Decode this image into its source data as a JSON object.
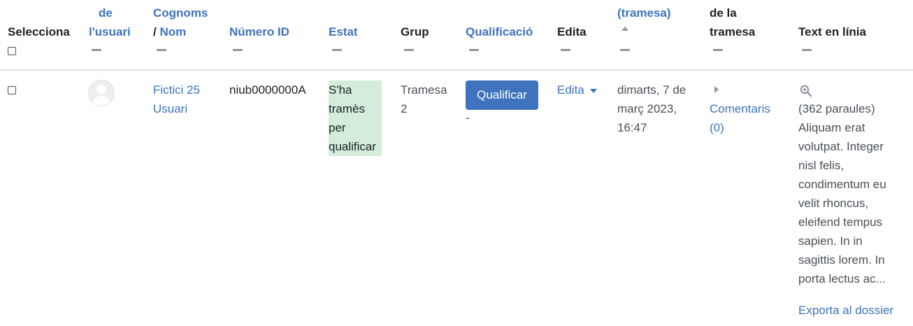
{
  "headers": {
    "select": "Selecciona",
    "picture_line1": "de",
    "picture_line2": "l'usuari",
    "name_line1": "Cognoms",
    "name_slash": "/",
    "name_line2": "Nom",
    "idnumber": "Número ID",
    "status": "Estat",
    "group": "Grup",
    "grade": "Qualificació",
    "edit": "Edita",
    "lastmodified": "(tramesa)",
    "comments_line1": "de la",
    "comments_line2": "tramesa",
    "onlinetext": "Text en línia"
  },
  "row": {
    "name_line1": "Fictici 25",
    "name_line2": "Usuari",
    "idnumber": "niub0000000A",
    "status_lines": [
      "S'ha",
      "tramès",
      "per",
      "qualificar"
    ],
    "group_line1": "Tramesa",
    "group_line2": "2",
    "grade_button": "Qualificar",
    "grade_value": "-",
    "edit_menu": "Edita",
    "modified_lines": [
      "dimarts, 7 de",
      "març 2023,",
      "16:47"
    ],
    "comments_line1": "Comentaris",
    "comments_line2": "(0)",
    "onlinetext_lines": [
      "(362 paraules)",
      "Aliquam erat",
      "volutpat. Integer",
      "nisl felis,",
      "condimentum eu",
      "velit rhoncus,",
      "eleifend tempus",
      "sapien. In in",
      "sagittis lorem. In",
      "porta lectus ac..."
    ],
    "export_link": "Exporta al dossier"
  },
  "colors": {
    "link": "#3f73bd",
    "button": "#3f73bd",
    "status_bg": "#d4edda"
  }
}
